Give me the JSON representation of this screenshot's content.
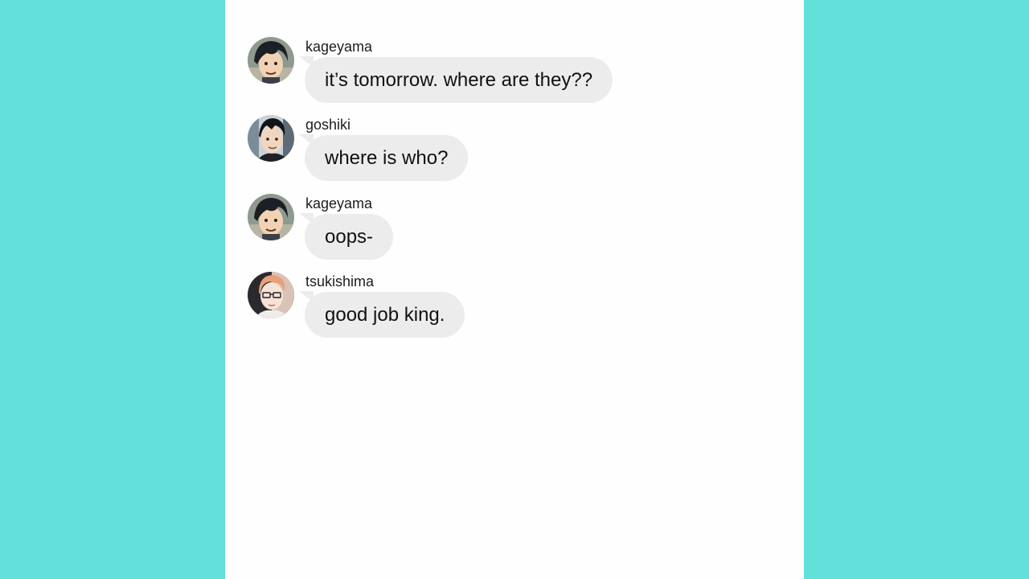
{
  "colors": {
    "background": "#62e0db",
    "panel": "#fefefe",
    "bubble": "#ececec"
  },
  "messages": [
    {
      "sender": "kageyama",
      "text": "it’s tomorrow. where are they??",
      "avatar_icon": "kageyama-avatar-icon"
    },
    {
      "sender": "goshiki",
      "text": "where is who?",
      "avatar_icon": "goshiki-avatar-icon"
    },
    {
      "sender": "kageyama",
      "text": "oops-",
      "avatar_icon": "kageyama-avatar-icon"
    },
    {
      "sender": "tsukishima",
      "text": "good job king.",
      "avatar_icon": "tsukishima-avatar-icon"
    }
  ]
}
